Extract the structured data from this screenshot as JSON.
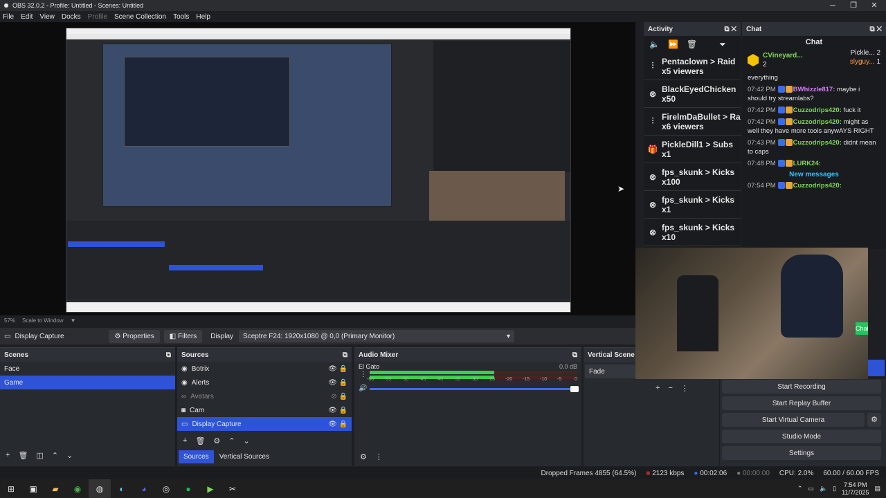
{
  "window": {
    "title": "OBS 32.0.2 - Profile: Untitled - Scenes: Untitled"
  },
  "menu": [
    "File",
    "Edit",
    "View",
    "Docks",
    "Profile",
    "Scene Collection",
    "Tools",
    "Help"
  ],
  "zoom": {
    "percent": "57%",
    "mode": "Scale to Window"
  },
  "source_toolbar": {
    "selected_source": "Display Capture",
    "properties_label": "Properties",
    "filters_label": "Filters",
    "display_label": "Display",
    "display_value": "Sceptre F24: 1920x1080 @ 0,0 (Primary Monitor)"
  },
  "scenes": {
    "title": "Scenes",
    "items": [
      "Face",
      "Game"
    ],
    "selected": "Game"
  },
  "sources": {
    "title": "Sources",
    "items": [
      "Botrix",
      "Alerts",
      "Avatars",
      "Cam",
      "Display Capture"
    ],
    "selected": "Display Capture",
    "tabs": [
      "Sources",
      "Vertical Sources"
    ]
  },
  "mixer": {
    "title": "Audio Mixer",
    "track_name": "El Gato",
    "track_db": "0.0 dB",
    "scale": [
      "-60",
      "-55",
      "-50",
      "-45",
      "-40",
      "-35",
      "-30",
      "-25",
      "-20",
      "-15",
      "-10",
      "-5",
      "0"
    ],
    "level": 0.6
  },
  "vertical": {
    "title": "Vertical Scene Tr",
    "transition": "Fade"
  },
  "controls": {
    "start_recording": "Start Recording",
    "start_replay_buffer": "Start Replay Buffer",
    "start_virtual_camera": "Start Virtual Camera",
    "studio_mode": "Studio Mode",
    "settings": "Settings"
  },
  "activity": {
    "title": "Activity",
    "items": [
      {
        "icon": "raid-icon",
        "line1": "Pentaclown > Raid",
        "line2": "x5 viewers"
      },
      {
        "icon": "kick-icon",
        "line1": "BlackEyedChicken",
        "line2": "x50"
      },
      {
        "icon": "raid-icon",
        "line1": "FirelmDaBullet > Ra",
        "line2": "x6 viewers"
      },
      {
        "icon": "gift-icon",
        "line1": "PickleDill1 > Subs",
        "line2": "x1"
      },
      {
        "icon": "kick-icon",
        "line1": "fps_skunk > Kicks",
        "line2": "x100"
      },
      {
        "icon": "kick-icon",
        "line1": "fps_skunk > Kicks",
        "line2": "x1"
      },
      {
        "icon": "kick-icon",
        "line1": "fps_skunk > Kicks",
        "line2": "x10"
      }
    ]
  },
  "chat": {
    "title": "Chat",
    "heading": "Chat",
    "top_user": "CVineyard...",
    "top_user_count": "2",
    "top_right_1": "Pickle...",
    "top_right_1_count": "2",
    "top_right_2": "slyguy...",
    "top_right_2_count": "1",
    "partial": "everything",
    "messages": [
      {
        "time": "07:42 PM",
        "name": "BWhizzle817:",
        "text": "maybe i should try streamlabs?",
        "color": "#d67cff"
      },
      {
        "time": "07:42 PM",
        "name": "Cuzzodrips420:",
        "text": "fuck it",
        "color": "#7ed957"
      },
      {
        "time": "07:42 PM",
        "name": "Cuzzodrips420:",
        "text": "might as well they have more tools anywAYS RIGHT",
        "color": "#7ed957"
      },
      {
        "time": "07:43 PM",
        "name": "Cuzzodrips420:",
        "text": "didnt mean to caps",
        "color": "#7ed957"
      },
      {
        "time": "07:48 PM",
        "name": "LURK24:",
        "text": "",
        "color": "#7ed957"
      }
    ],
    "new_messages": "New messages",
    "after": [
      {
        "time": "07:54 PM",
        "name": "Cuzzodrips420:",
        "text": "",
        "color": "#7ed957"
      }
    ],
    "chat_button": "Chat"
  },
  "status": {
    "dropped": "Dropped Frames 4855 (64.5%)",
    "bitrate": "2123 kbps",
    "stream_time": "00:02:06",
    "rec_time": "00:00:00",
    "cpu": "CPU: 2.0%",
    "fps": "60.00 / 60.00 FPS"
  },
  "clock": {
    "time": "7:54 PM",
    "date": "11/7/2025"
  },
  "colors": {
    "accent": "#2e53d6",
    "meter_green": "#3bd04a",
    "meter_yellow": "#c9a826",
    "meter_red": "#a82e2e"
  }
}
